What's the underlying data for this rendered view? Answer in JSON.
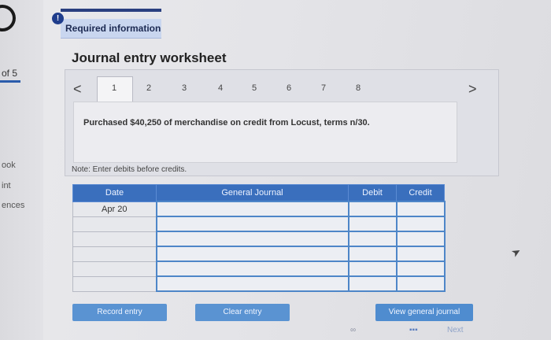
{
  "sidebar": {
    "counter": "of 5",
    "labels": [
      "ook",
      "int",
      "ences"
    ]
  },
  "required": {
    "badge": "!",
    "label": "Required information"
  },
  "worksheet": {
    "title": "Journal entry worksheet",
    "prev": "<",
    "next": ">",
    "tabs": [
      "1",
      "2",
      "3",
      "4",
      "5",
      "6",
      "7",
      "8"
    ],
    "active_tab": "1",
    "description": "Purchased $40,250 of merchandise on credit from Locust, terms n/30."
  },
  "note": "Note: Enter debits before credits.",
  "table": {
    "headers": [
      "Date",
      "General Journal",
      "Debit",
      "Credit"
    ],
    "rows": [
      {
        "date": "Apr 20",
        "account": "",
        "debit": "",
        "credit": ""
      },
      {
        "date": "",
        "account": "",
        "debit": "",
        "credit": ""
      },
      {
        "date": "",
        "account": "",
        "debit": "",
        "credit": ""
      },
      {
        "date": "",
        "account": "",
        "debit": "",
        "credit": ""
      },
      {
        "date": "",
        "account": "",
        "debit": "",
        "credit": ""
      },
      {
        "date": "",
        "account": "",
        "debit": "",
        "credit": ""
      }
    ]
  },
  "buttons": {
    "record": "Record entry",
    "clear": "Clear entry",
    "view": "View general journal"
  },
  "footer": {
    "next": "Next"
  },
  "colors": {
    "header_blue": "#3a6fbd",
    "button_blue": "#5a93d2",
    "badge_blue": "#1f3d8c"
  }
}
